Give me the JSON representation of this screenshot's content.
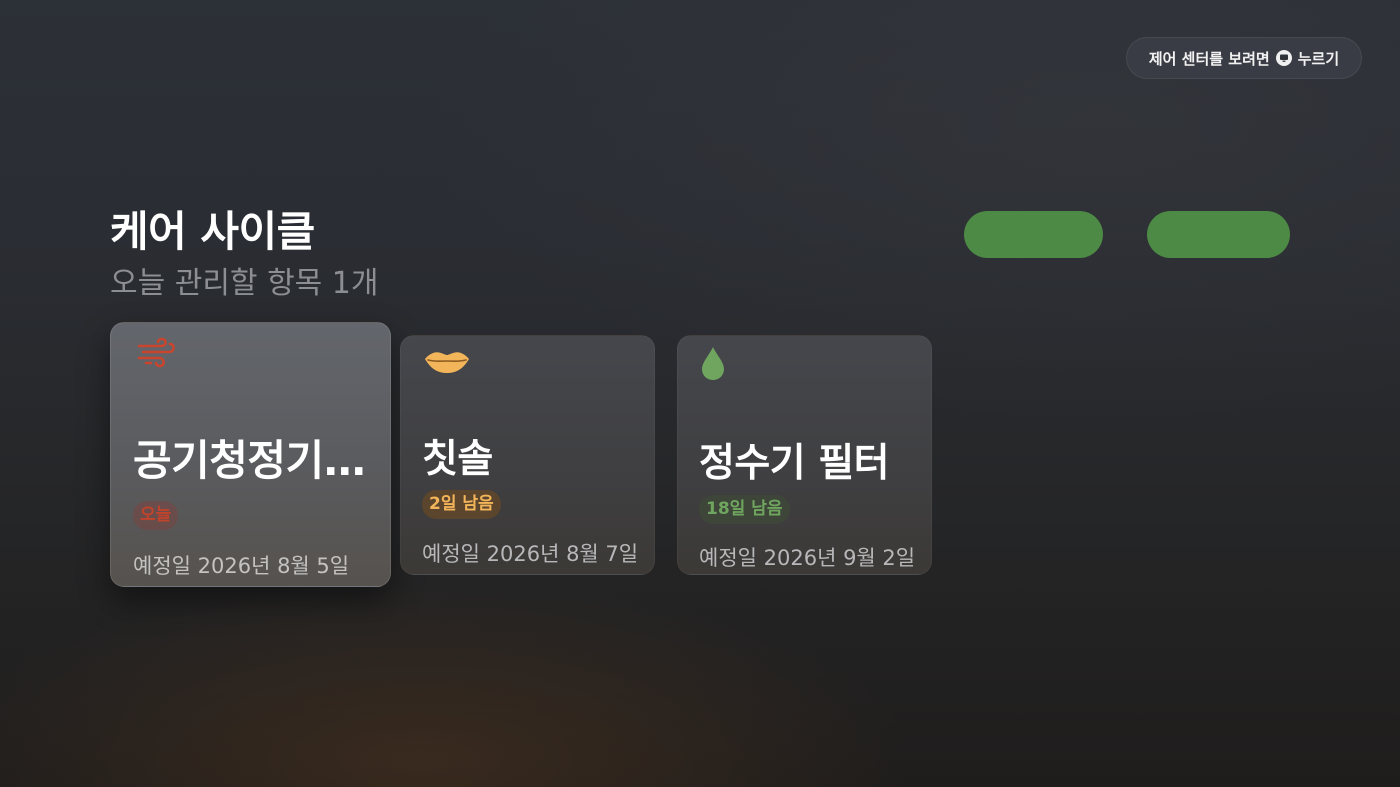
{
  "control_center": {
    "prefix": "제어 센터를 보려면",
    "suffix": "누르기",
    "icon": "tv-remote-button-icon"
  },
  "header": {
    "title": "케어 사이클",
    "subtitle": "오늘 관리할 항목 1개"
  },
  "actions": {
    "button_color": "#4d8a45"
  },
  "cards": [
    {
      "icon": "wind-icon",
      "icon_color": "#c9452d",
      "title": "공기청정기 필터",
      "badge": "오늘",
      "badge_color": "#c0432c",
      "date": "예정일 2026년 8월 5일",
      "focused": true
    },
    {
      "icon": "mouth-icon",
      "icon_color": "#f3b55a",
      "title": "칫솔",
      "badge": "2일 남음",
      "badge_color": "#f3b55a",
      "date": "예정일 2026년 8월 7일"
    },
    {
      "icon": "water-drop-icon",
      "icon_color": "#6fa55e",
      "title": "정수기 필터",
      "badge": "18일 남음",
      "badge_color": "#6fa55e",
      "date": "예정일 2026년 9월 2일"
    }
  ]
}
